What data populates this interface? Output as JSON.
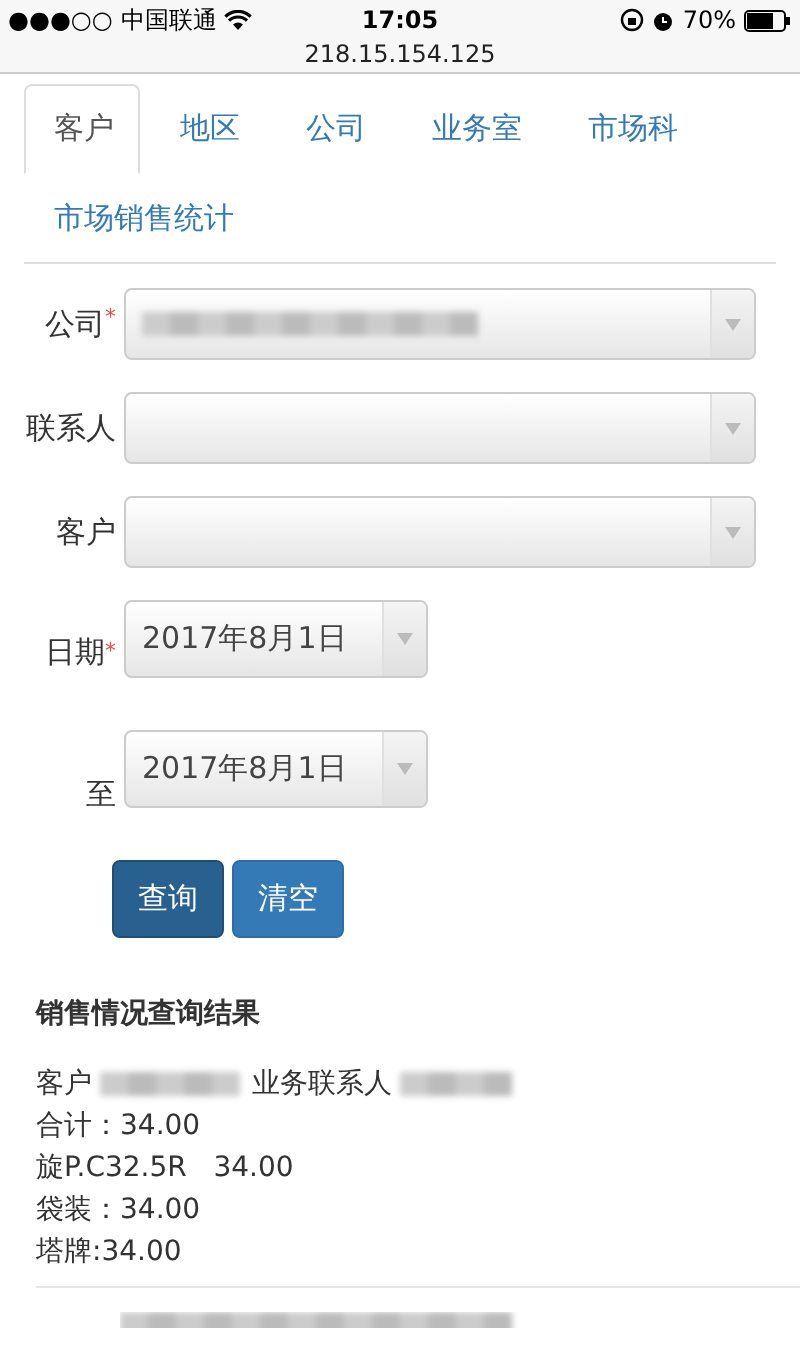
{
  "status_bar": {
    "signal": "●●●○○",
    "carrier": "中国联通",
    "time": "17:05",
    "battery": "70%"
  },
  "address_bar": {
    "url": "218.15.154.125"
  },
  "tabs": [
    {
      "label": "客户",
      "selected": true
    },
    {
      "label": "地区",
      "selected": false
    },
    {
      "label": "公司",
      "selected": false
    },
    {
      "label": "业务室",
      "selected": false
    },
    {
      "label": "市场科",
      "selected": false
    },
    {
      "label": "市场销售统计",
      "selected": false
    }
  ],
  "form": {
    "fields": [
      {
        "kind": "select",
        "label": "公司",
        "required_mark": "*",
        "redacted": true
      },
      {
        "kind": "select",
        "label": "联系人",
        "redacted": false
      },
      {
        "kind": "select",
        "label": "客户",
        "redacted": false
      },
      {
        "kind": "date",
        "label": "日期",
        "required_mark": "*",
        "value": "2017年8月1日"
      },
      {
        "kind": "date",
        "label": "至",
        "value": "2017年8月1日"
      }
    ]
  },
  "buttons": [
    {
      "label": "查询",
      "pressed": true
    },
    {
      "label": "清空",
      "pressed": false
    }
  ],
  "results": {
    "title": "销售情况查询结果",
    "lines": [
      {
        "kind": "pair",
        "items": [
          "客户",
          "业务联系人"
        ]
      },
      {
        "kind": "text",
        "text": "合计：34.00"
      },
      {
        "kind": "text",
        "text": "旋P.C32.5R   34.00"
      },
      {
        "kind": "text",
        "text": "袋装：34.00"
      },
      {
        "kind": "text",
        "text": "塔牌:34.00"
      }
    ]
  }
}
